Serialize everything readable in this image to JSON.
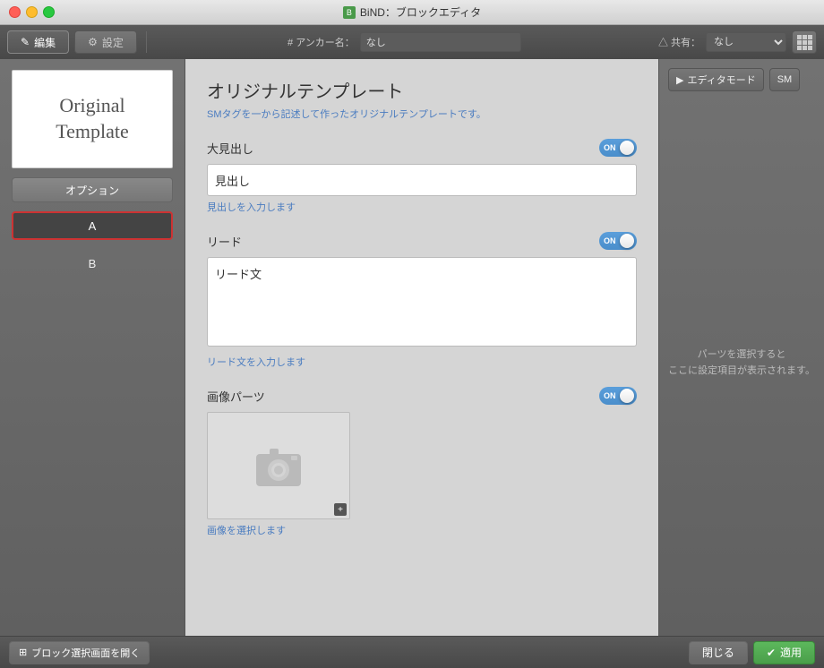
{
  "titlebar": {
    "title": "BiND：ブロックエディタ",
    "icon_label": "B"
  },
  "toolbar": {
    "edit_label": "編集",
    "settings_label": "設定",
    "anchor_label": "# アンカー名：",
    "anchor_value": "なし",
    "share_label": "△ 共有：",
    "share_value": "なし"
  },
  "right_panel": {
    "mode_btn_label": "エディタモード",
    "sm_btn_label": "SM",
    "empty_text": "パーツを選択すると\nここに設定項目が表示されます。"
  },
  "sidebar": {
    "template_text_line1": "Original",
    "template_text_line2": "Template",
    "options_label": "オプション",
    "item_a": "A",
    "item_b": "B"
  },
  "content": {
    "title": "オリジナルテンプレート",
    "subtitle": "SMタグを一から記述して作ったオリジナルテンプレートです。",
    "heading_section": {
      "label": "大見出し",
      "toggle_on": "ON",
      "input_value": "見出し",
      "hint": "見出しを入力します"
    },
    "lead_section": {
      "label": "リード",
      "toggle_on": "ON",
      "textarea_value": "リード文",
      "hint": "リード文を入力します"
    },
    "image_section": {
      "label": "画像パーツ",
      "toggle_on": "ON",
      "hint": "画像を選択します"
    }
  },
  "bottom": {
    "open_block_label": "ブロック選択画面を開く",
    "close_label": "閉じる",
    "apply_label": "適用"
  }
}
